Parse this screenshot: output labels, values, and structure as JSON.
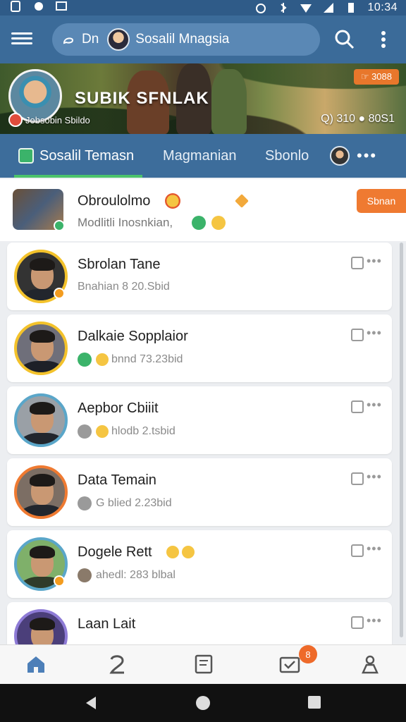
{
  "status_bar": {
    "time": "10:34"
  },
  "app_bar": {
    "search_prefix": "Dn",
    "search_text": "Sosalil Mnagsia"
  },
  "banner": {
    "title": "SUBIK SFNLAK",
    "subtitle": "Jobsobin  Sbildo",
    "stats": "Q) 310  ● 80S1",
    "tag": "☞ 3088"
  },
  "tabs": [
    {
      "label": "Sosalil Temasn"
    },
    {
      "label": "Magmanian"
    },
    {
      "label": "Sbonlo"
    }
  ],
  "tabs_more": "•••",
  "feed_top": {
    "title": "Obroulolmo",
    "sub": "Modlitli Inosnkian,",
    "follow_label": "Sbnan"
  },
  "cards": [
    {
      "name": "Sbrolan Tane",
      "meta": "Bnahian  8 20.Sbid",
      "dots": "•••"
    },
    {
      "name": "Dalkaie Sopplaior",
      "meta": "bnnd  73.23bid",
      "dots": "•••"
    },
    {
      "name": "Aepbor Cbiiit",
      "meta": "hlodb 2.tsbid",
      "dots": "•••"
    },
    {
      "name": "Data Temain",
      "meta": "G blied 2.23bid",
      "dots": "•••"
    },
    {
      "name": "Dogele Rett",
      "meta": "ahedl: 283 blbal",
      "dots": "•••"
    },
    {
      "name": "Laan Lait",
      "meta": "",
      "dots": "•••"
    }
  ],
  "bottom_nav": {
    "badge": "8"
  },
  "colors": {
    "primary": "#3b6b99",
    "accent": "#ef7a31",
    "active_tab": "#4cc36c"
  }
}
